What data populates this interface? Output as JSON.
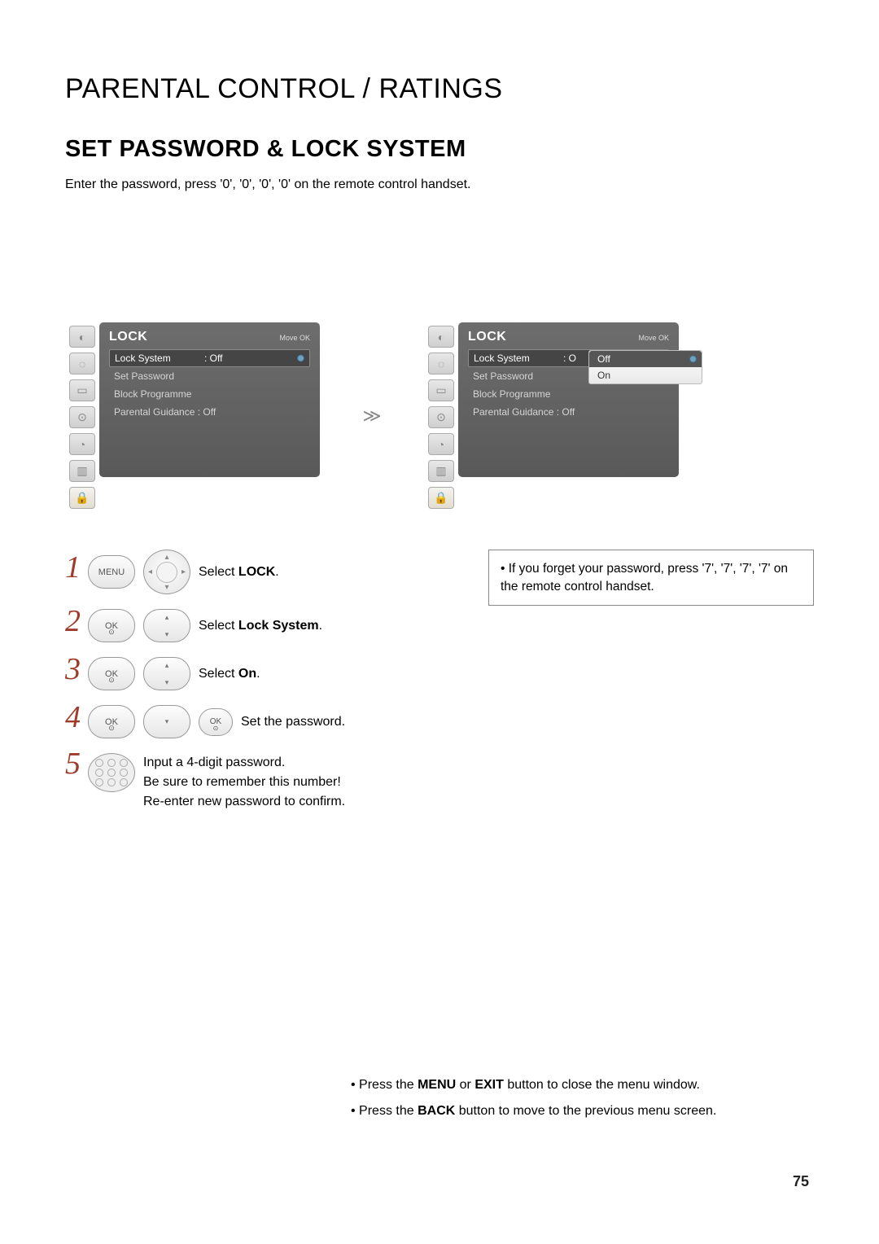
{
  "page_title": "PARENTAL CONTROL / RATINGS",
  "section_title": "SET PASSWORD & LOCK SYSTEM",
  "intro": "Enter the password, press '0', '0', '0', '0' on the remote control handset.",
  "panel_title": "LOCK",
  "panel_hint": "Move    OK",
  "menu_left": {
    "lock_system_label": "Lock System",
    "lock_system_value": ": Off",
    "set_password": "Set Password",
    "block_programme": "Block Programme",
    "parental_guidance": "Parental Guidance : Off"
  },
  "menu_right": {
    "lock_system_label": "Lock System",
    "lock_system_value": ": O",
    "set_password": "Set Password",
    "block_programme": "Block Programme",
    "parental_guidance": "Parental Guidance  : Off",
    "popup_off": "Off",
    "popup_on": "On"
  },
  "buttons": {
    "menu": "MENU",
    "ok": "OK"
  },
  "steps": {
    "s1_pre": "Select ",
    "s1_b": "LOCK",
    "s1_post": ".",
    "s2_pre": "Select ",
    "s2_b": "Lock System",
    "s2_post": ".",
    "s3_pre": "Select ",
    "s3_b": "On",
    "s3_post": ".",
    "s4": "Set the password.",
    "s5a": "Input a 4-digit password.",
    "s5b": "Be sure to remember this number!",
    "s5c": "Re-enter new password to confirm."
  },
  "tip": "• If you forget your password, press '7', '7', '7', '7' on the remote control handset.",
  "footer1_pre": "• Press the ",
  "footer1_b1": "MENU",
  "footer1_mid": " or ",
  "footer1_b2": "EXIT",
  "footer1_post": " button to close the menu window.",
  "footer2_pre": "• Press the ",
  "footer2_b": "BACK",
  "footer2_post": " button to move to the previous menu screen.",
  "page_number": "75"
}
